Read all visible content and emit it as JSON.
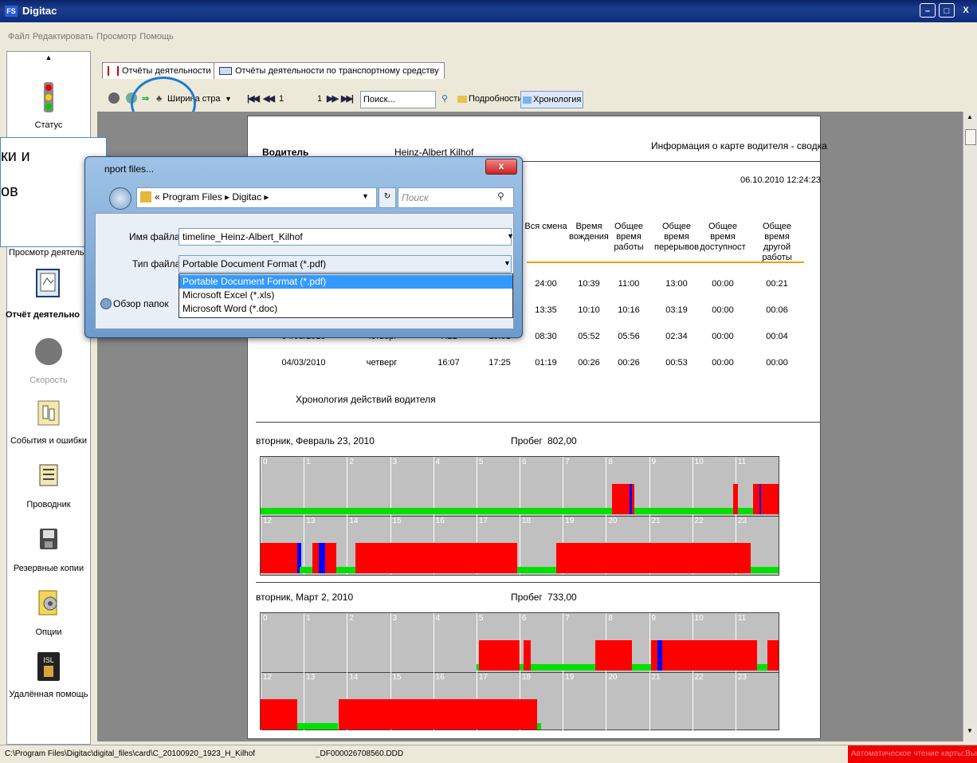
{
  "window": {
    "title": "Digitac",
    "icon_text": "FS",
    "minimize": "–",
    "maximize": "□",
    "close": "X"
  },
  "menu": [
    "Файл",
    "Редактировать",
    "Просмотр",
    "Помощь"
  ],
  "sidebar": {
    "scroll_up": "▲",
    "items": [
      {
        "label": "Статус",
        "icon": "traffic-light-icon"
      },
      {
        "label": "Просмотр деятельн",
        "icon": "view-activity-icon"
      },
      {
        "label": "Отчёт деятельно",
        "icon": "report-icon"
      },
      {
        "label": "Скорость",
        "icon": "speed-icon"
      },
      {
        "label": "События и ошибки",
        "icon": "events-icon"
      },
      {
        "label": "Проводник",
        "icon": "explorer-icon"
      },
      {
        "label": "Резервные копии",
        "icon": "backup-icon"
      },
      {
        "label": "Опции",
        "icon": "options-icon"
      },
      {
        "label": "Удалённая помощь",
        "icon": "remote-help-icon"
      }
    ]
  },
  "tabs": [
    {
      "label": "Отчёты деятельности",
      "active": true
    },
    {
      "label": "Отчёты деятельности по транспортному средству",
      "active": false
    }
  ],
  "toolbar": {
    "zoom": "Ширина стра",
    "page_current": "1",
    "page_total": "1",
    "search": "Поиск...",
    "details": "Подробности",
    "chronology": "Хронология"
  },
  "report": {
    "title": "Информация о карте водителя - сводка",
    "driver_label": "Водитель",
    "driver_name": "Heinz-Albert Kilhof",
    "date": "06.10.2010  12:24:23",
    "columns": [
      "Вся смена",
      "Время вождения",
      "Общее время работы",
      "Общее время перерывов",
      "Общее время доступност",
      "Общее время другой работы"
    ],
    "rows": [
      {
        "date": "",
        "day": "",
        "start": "",
        "end": "",
        "vals": [
          "24:00",
          "10:39",
          "11:00",
          "13:00",
          "00:00",
          "00:21"
        ]
      },
      {
        "date": "",
        "day": "",
        "start": "",
        "end": "",
        "vals": [
          "13:35",
          "10:10",
          "10:16",
          "03:19",
          "00:00",
          "00:06"
        ]
      },
      {
        "date": "04/03/2010",
        "day": "четверг",
        "start": "7:22",
        "end": "15:51",
        "vals": [
          "08:30",
          "05:52",
          "05:56",
          "02:34",
          "00:00",
          "00:04"
        ]
      },
      {
        "date": "04/03/2010",
        "day": "четверг",
        "start": "16:07",
        "end": "17:25",
        "vals": [
          "01:19",
          "00:26",
          "00:26",
          "00:53",
          "00:00",
          "00:00"
        ]
      }
    ],
    "chronology_title": "Хронология действий водителя",
    "days": [
      {
        "label": "вторник, Февраль 23, 2010",
        "mileage_label": "Пробег",
        "mileage": "802,00"
      },
      {
        "label": "вторник, Март 2, 2010",
        "mileage_label": "Пробег",
        "mileage": "733,00"
      }
    ],
    "hours_row1": [
      "0",
      "1",
      "2",
      "3",
      "4",
      "5",
      "6",
      "7",
      "8",
      "9",
      "10",
      "11"
    ],
    "hours_row2": [
      "12",
      "13",
      "14",
      "15",
      "16",
      "17",
      "18",
      "19",
      "20",
      "21",
      "22",
      "23"
    ]
  },
  "colors": {
    "driving": "#ff0000",
    "rest": "#00e000",
    "work": "#0000ff",
    "empty": "#c0c0c0"
  },
  "dialog": {
    "title": "nport  files...",
    "breadcrumb": "«  Program Files  ▸  Digitac  ▸",
    "search_placeholder": "Поиск",
    "filename_label": "Имя файла:",
    "filename_value": "timeline_Heinz-Albert_Kilhof",
    "filetype_label": "Тип файла:",
    "filetype_value": "Portable Document Format (*.pdf)",
    "options": [
      "Portable Document Format (*.pdf)",
      "Microsoft Excel (*.xls)",
      "Microsoft Word (*.doc)"
    ],
    "browse_label": "Обзор папок",
    "close": "x"
  },
  "tooltip": {
    "line1": "ки и",
    "line2": "ов"
  },
  "status": {
    "path": "C:\\Program Files\\Digitac\\digital_files\\card\\C_20100920_1923_H_Kilhof",
    "file": "_DF000026708560.DDD",
    "auto_read": "Автоматическое чтение карты:Вык"
  }
}
